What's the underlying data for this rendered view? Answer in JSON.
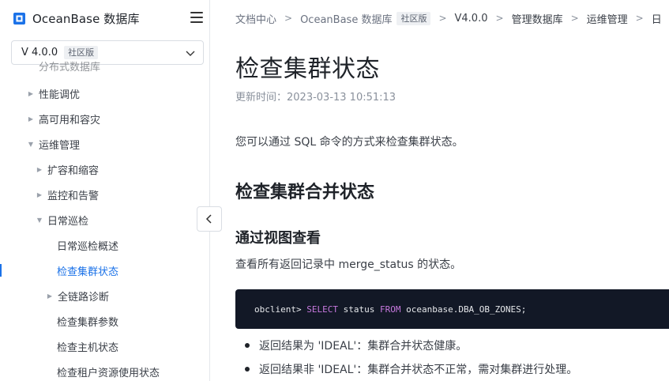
{
  "sidebar": {
    "brand": "OceanBase 数据库",
    "version": {
      "value": "V 4.0.0",
      "tag": "社区版"
    },
    "items": [
      {
        "label": "分布式数据库",
        "arrow": ""
      },
      {
        "label": "性能调优",
        "arrow": "▶"
      },
      {
        "label": "高可用和容灾",
        "arrow": "▶"
      },
      {
        "label": "运维管理",
        "arrow": "▼"
      },
      {
        "label": "扩容和缩容",
        "arrow": "▶"
      },
      {
        "label": "监控和告警",
        "arrow": "▶"
      },
      {
        "label": "日常巡检",
        "arrow": "▼"
      },
      {
        "label": "日常巡检概述",
        "arrow": ""
      },
      {
        "label": "检查集群状态",
        "arrow": ""
      },
      {
        "label": "全链路诊断",
        "arrow": "▶"
      },
      {
        "label": "检查集群参数",
        "arrow": ""
      },
      {
        "label": "检查主机状态",
        "arrow": ""
      },
      {
        "label": "检查租户资源使用状态",
        "arrow": ""
      }
    ]
  },
  "breadcrumb": {
    "items": [
      "文档中心",
      "OceanBase 数据库",
      "V4.0.0",
      "管理数据库",
      "运维管理",
      "日"
    ],
    "tag": "社区版",
    "separator": ">"
  },
  "article": {
    "title": "检查集群状态",
    "updated": "更新时间：2023-03-13 10:51:13",
    "intro": "您可以通过 SQL 命令的方式来检查集群状态。",
    "h2": "检查集群合并状态",
    "h3": "通过视图查看",
    "para": "查看所有返回记录中 merge_status 的状态。",
    "code": {
      "prompt": "obclient> ",
      "kw_select": "SELECT",
      "col": " status ",
      "kw_from": "FROM",
      "table": " oceanbase.DBA_OB_ZONES;"
    },
    "bullets": [
      "返回结果为 'IDEAL'：集群合并状态健康。",
      "返回结果非 'IDEAL'：集群合并状态不正常，需对集群进行处理。"
    ]
  },
  "colors": {
    "accent": "#1b72e8",
    "code_bg": "#121826",
    "keyword": "#c678dd"
  }
}
